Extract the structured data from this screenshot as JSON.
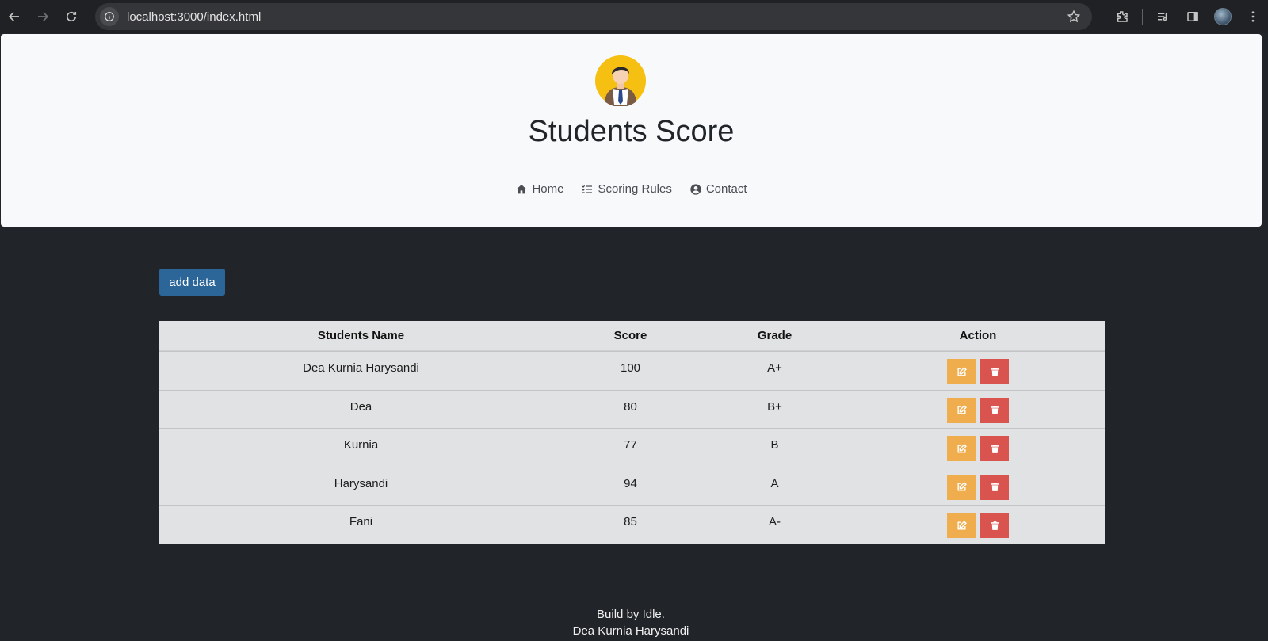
{
  "browser": {
    "url": "localhost:3000/index.html"
  },
  "header": {
    "title": "Students Score",
    "nav": [
      {
        "label": "Home",
        "icon": "home-icon"
      },
      {
        "label": "Scoring Rules",
        "icon": "list-check-icon"
      },
      {
        "label": "Contact",
        "icon": "user-circle-icon"
      }
    ]
  },
  "main": {
    "add_label": "add data",
    "table": {
      "headers": [
        "Students Name",
        "Score",
        "Grade",
        "Action"
      ],
      "rows": [
        {
          "name": "Dea Kurnia Harysandi",
          "score": "100",
          "grade": "A+"
        },
        {
          "name": "Dea",
          "score": "80",
          "grade": "B+"
        },
        {
          "name": "Kurnia",
          "score": "77",
          "grade": "B"
        },
        {
          "name": "Harysandi",
          "score": "94",
          "grade": "A"
        },
        {
          "name": "Fani",
          "score": "85",
          "grade": "A-"
        }
      ]
    }
  },
  "footer": {
    "line1": "Build by Idle.",
    "line2": "Dea Kurnia Harysandi"
  },
  "colors": {
    "add_button": "#2c6698",
    "edit_button": "#f0ad4e",
    "delete_button": "#d9534f",
    "page_bg": "#212428",
    "header_bg": "#f8f9fa"
  }
}
